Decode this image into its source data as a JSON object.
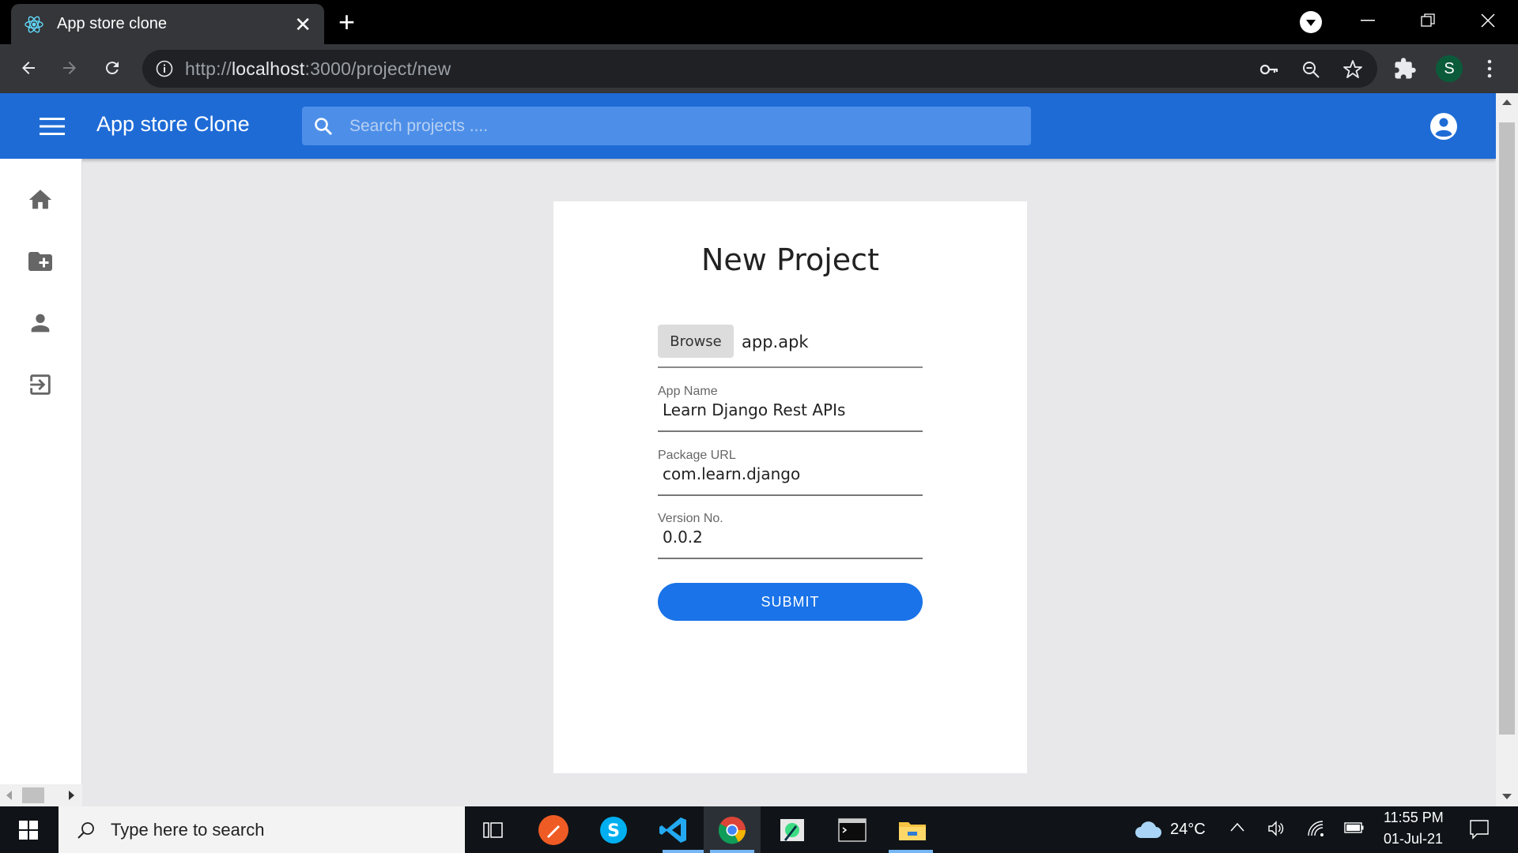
{
  "browser": {
    "tab_title": "App store clone",
    "url_prefix": "http://",
    "url_host": "localhost",
    "url_path": ":3000/project/new",
    "profile_initial": "S"
  },
  "app": {
    "title": "App store Clone",
    "search_placeholder": "Search projects ....",
    "sidebar_items": [
      "home-icon",
      "create-folder-icon",
      "person-icon",
      "logout-icon"
    ]
  },
  "form": {
    "title": "New Project",
    "browse_label": "Browse",
    "file_name": "app.apk",
    "fields": [
      {
        "label": "App Name",
        "value": "Learn Django Rest APIs"
      },
      {
        "label": "Package URL",
        "value": "com.learn.django"
      },
      {
        "label": "Version No.",
        "value": "0.0.2"
      }
    ],
    "submit_label": "SUBMIT"
  },
  "taskbar": {
    "search_placeholder": "Type here to search",
    "temperature": "24°C",
    "time": "11:55 PM",
    "date": "01-Jul-21"
  },
  "colors": {
    "appbar": "#1e6bd6",
    "submit": "#1a73e8",
    "chrome_dark": "#35363a"
  }
}
